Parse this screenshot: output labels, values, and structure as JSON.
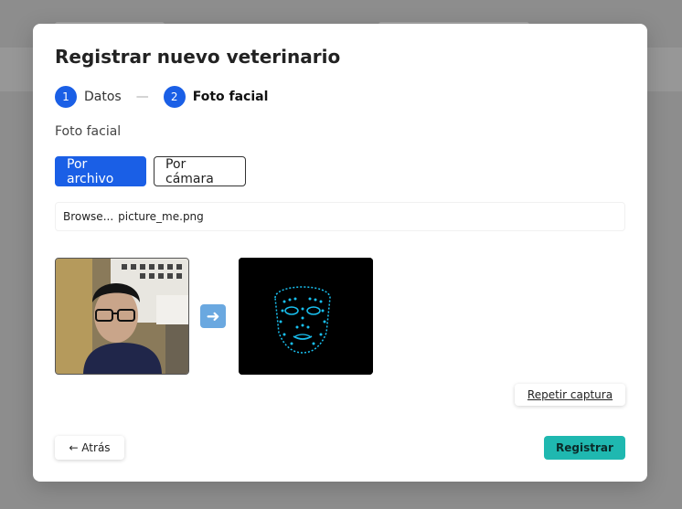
{
  "modal": {
    "title": "Registrar nuevo veterinario",
    "steps": [
      {
        "number": "1",
        "label": "Datos"
      },
      {
        "number": "2",
        "label": "Foto facial"
      }
    ],
    "step_separator": "—",
    "section_label": "Foto facial",
    "modes": {
      "file": "Por archivo",
      "camera": "Por cámara"
    },
    "file_input": {
      "browse": "Browse...",
      "filename": "picture_me.png"
    },
    "images": {
      "photo": "person-photo",
      "mesh": "face-mesh-image"
    },
    "arrow_icon": "right-arrow-icon",
    "retry_label": "Repetir captura",
    "back_label": "← Atrás",
    "submit_label": "Registrar"
  },
  "colors": {
    "primary": "#1a5fe6",
    "submit": "#1fb8b0",
    "mesh": "#19c0f0"
  }
}
